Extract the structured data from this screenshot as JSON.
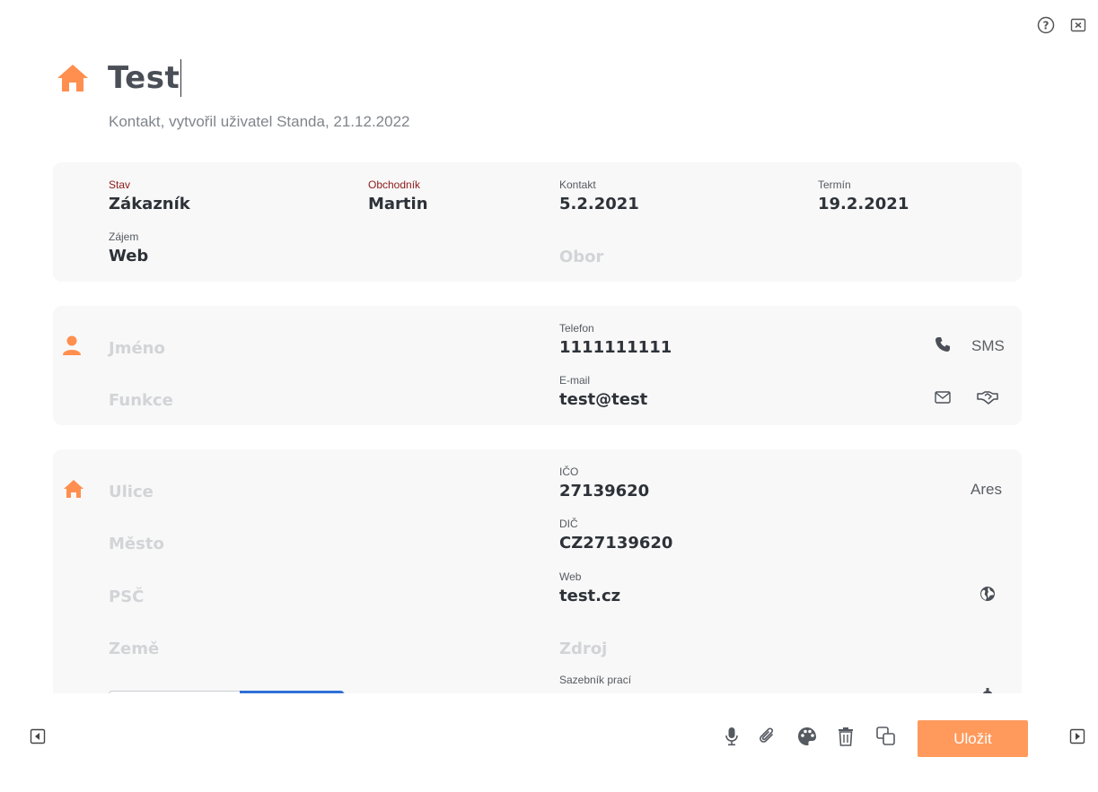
{
  "header": {
    "title": "Test",
    "subtitle": "Kontakt, vytvořil uživatel Standa, 21.12.2022"
  },
  "summary": {
    "stav_label": "Stav",
    "stav_value": "Zákazník",
    "obchodnik_label": "Obchodník",
    "obchodnik_value": "Martin",
    "kontakt_label": "Kontakt",
    "kontakt_value": "5.2.2021",
    "termin_label": "Termín",
    "termin_value": "19.2.2021",
    "zajem_label": "Zájem",
    "zajem_value": "Web",
    "obor_placeholder": "Obor"
  },
  "person": {
    "jmeno_placeholder": "Jméno",
    "funkce_placeholder": "Funkce",
    "telefon_label": "Telefon",
    "telefon_value": "1111111111",
    "email_label": "E-mail",
    "email_value": "test@test",
    "sms_label": "SMS"
  },
  "company": {
    "ulice_placeholder": "Ulice",
    "mesto_placeholder": "Město",
    "psc_placeholder": "PSČ",
    "zeme_placeholder": "Země",
    "ico_label": "IČO",
    "ico_value": "27139620",
    "dic_label": "DIČ",
    "dic_value": "CZ27139620",
    "web_label": "Web",
    "web_value": "test.cz",
    "zdroj_placeholder": "Zdroj",
    "sazebnik_label": "Sazebník prací",
    "ares_label": "Ares"
  },
  "footer": {
    "save_label": "Uložit"
  },
  "colors": {
    "accent": "#ff9a5c",
    "label_red": "#8b1a1a",
    "card_bg": "#f8f8f8"
  }
}
